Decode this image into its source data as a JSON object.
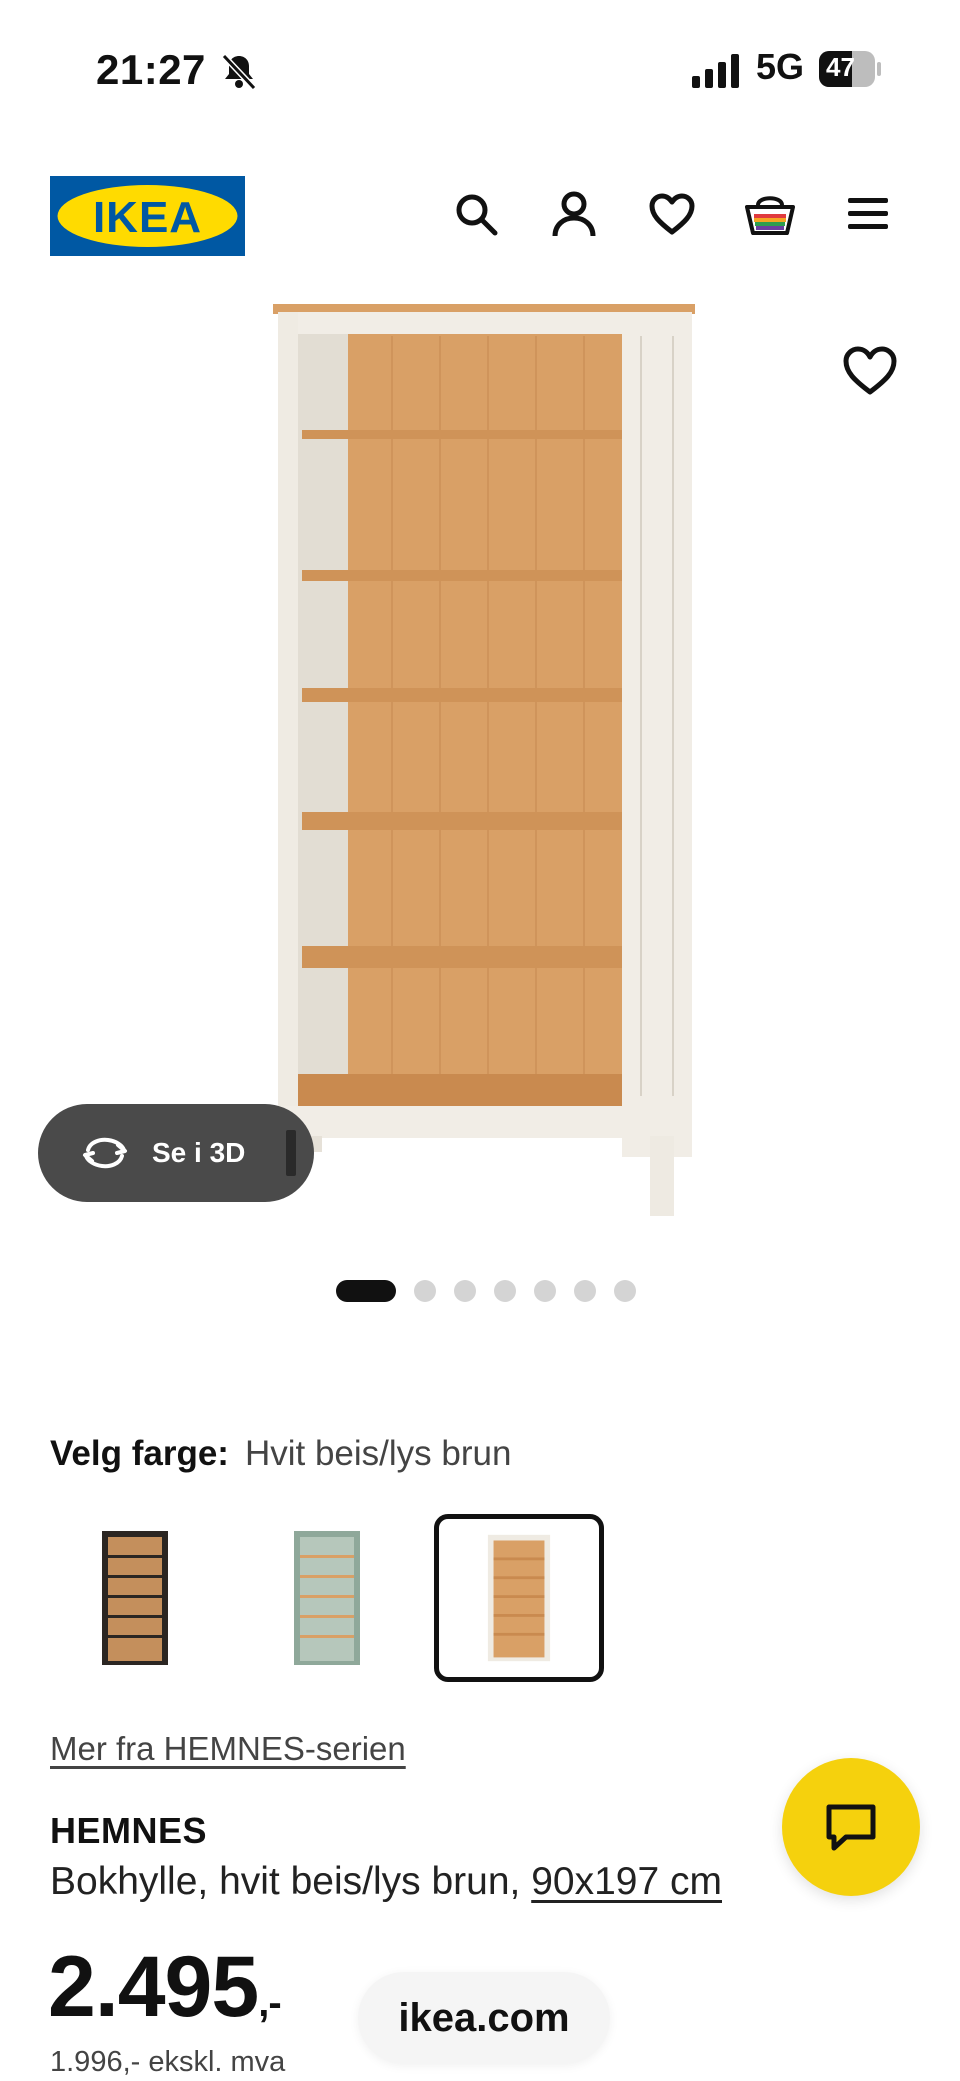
{
  "status_bar": {
    "time": "21:27",
    "network": "5G",
    "battery": "47"
  },
  "header": {
    "logo_text": "IKEA",
    "icons": [
      "search-icon",
      "account-icon",
      "heart-icon",
      "cart-icon",
      "menu-icon"
    ]
  },
  "hero": {
    "see_in_3d": "Se i 3D",
    "image_count": 7,
    "active_image": 1
  },
  "product": {
    "color_label": "Velg farge:",
    "color_value": "Hvit beis/lys brun",
    "swatches": [
      {
        "name": "black-brown",
        "selected": false
      },
      {
        "name": "grey-green",
        "selected": false
      },
      {
        "name": "white-stain-light-brown",
        "selected": true
      }
    ],
    "series_link": "Mer fra HEMNES-serien",
    "name": "HEMNES",
    "description": "Bokhylle, hvit beis/lys brun, ",
    "size": "90x197 cm",
    "price_main": "2.495",
    "price_suffix": ",-",
    "price_ex_vat": "1.996,- ekskl. mva"
  },
  "browser": {
    "domain": "ikea.com"
  },
  "colors": {
    "ikea_blue": "#0058A3",
    "ikea_yellow": "#FFDB00",
    "chat_yellow": "#F5D10D",
    "wood": "#D9A066"
  }
}
